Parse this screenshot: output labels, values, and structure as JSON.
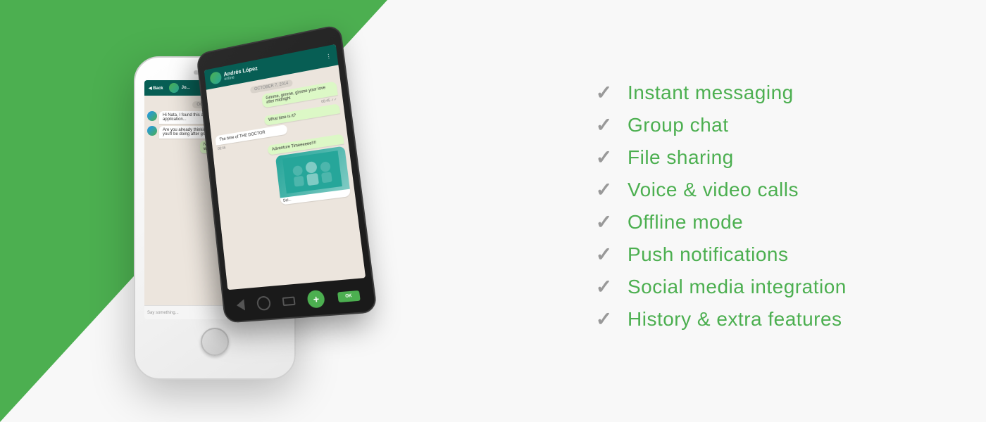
{
  "background": {
    "green_color": "#4caf50",
    "white_color": "#f8f8f8"
  },
  "phones": {
    "iphone": {
      "chat_placeholder": "Say something...",
      "chat_messages": [
        {
          "side": "left",
          "text": "Hi Nata..."
        },
        {
          "side": "left",
          "text": "Are you already..."
        },
        {
          "side": "left",
          "text": "No, I have on but it wou job lined up..."
        }
      ]
    },
    "android": {
      "contact_name": "Andrés López",
      "contact_status": "online",
      "date_label": "OCTOBER 7, 2014",
      "messages": [
        {
          "side": "right",
          "text": "Gimme, gimme, gimme your love after midnight"
        },
        {
          "side": "right",
          "text": "What time is it?"
        },
        {
          "side": "left",
          "text": "The time of THE DOCTOR"
        },
        {
          "side": "right",
          "text": "Adventure Timeeeeee!!!!"
        }
      ]
    }
  },
  "features": [
    {
      "id": "instant-messaging",
      "label": "Instant messaging"
    },
    {
      "id": "group-chat",
      "label": "Group chat"
    },
    {
      "id": "file-sharing",
      "label": "File sharing"
    },
    {
      "id": "voice-video-calls",
      "label": "Voice & video calls"
    },
    {
      "id": "offline-mode",
      "label": "Offline mode"
    },
    {
      "id": "push-notifications",
      "label": "Push notifications"
    },
    {
      "id": "social-media-integration",
      "label": "Social media integration"
    },
    {
      "id": "history-extra-features",
      "label": "History & extra features"
    }
  ],
  "checkmark_symbol": "✓"
}
